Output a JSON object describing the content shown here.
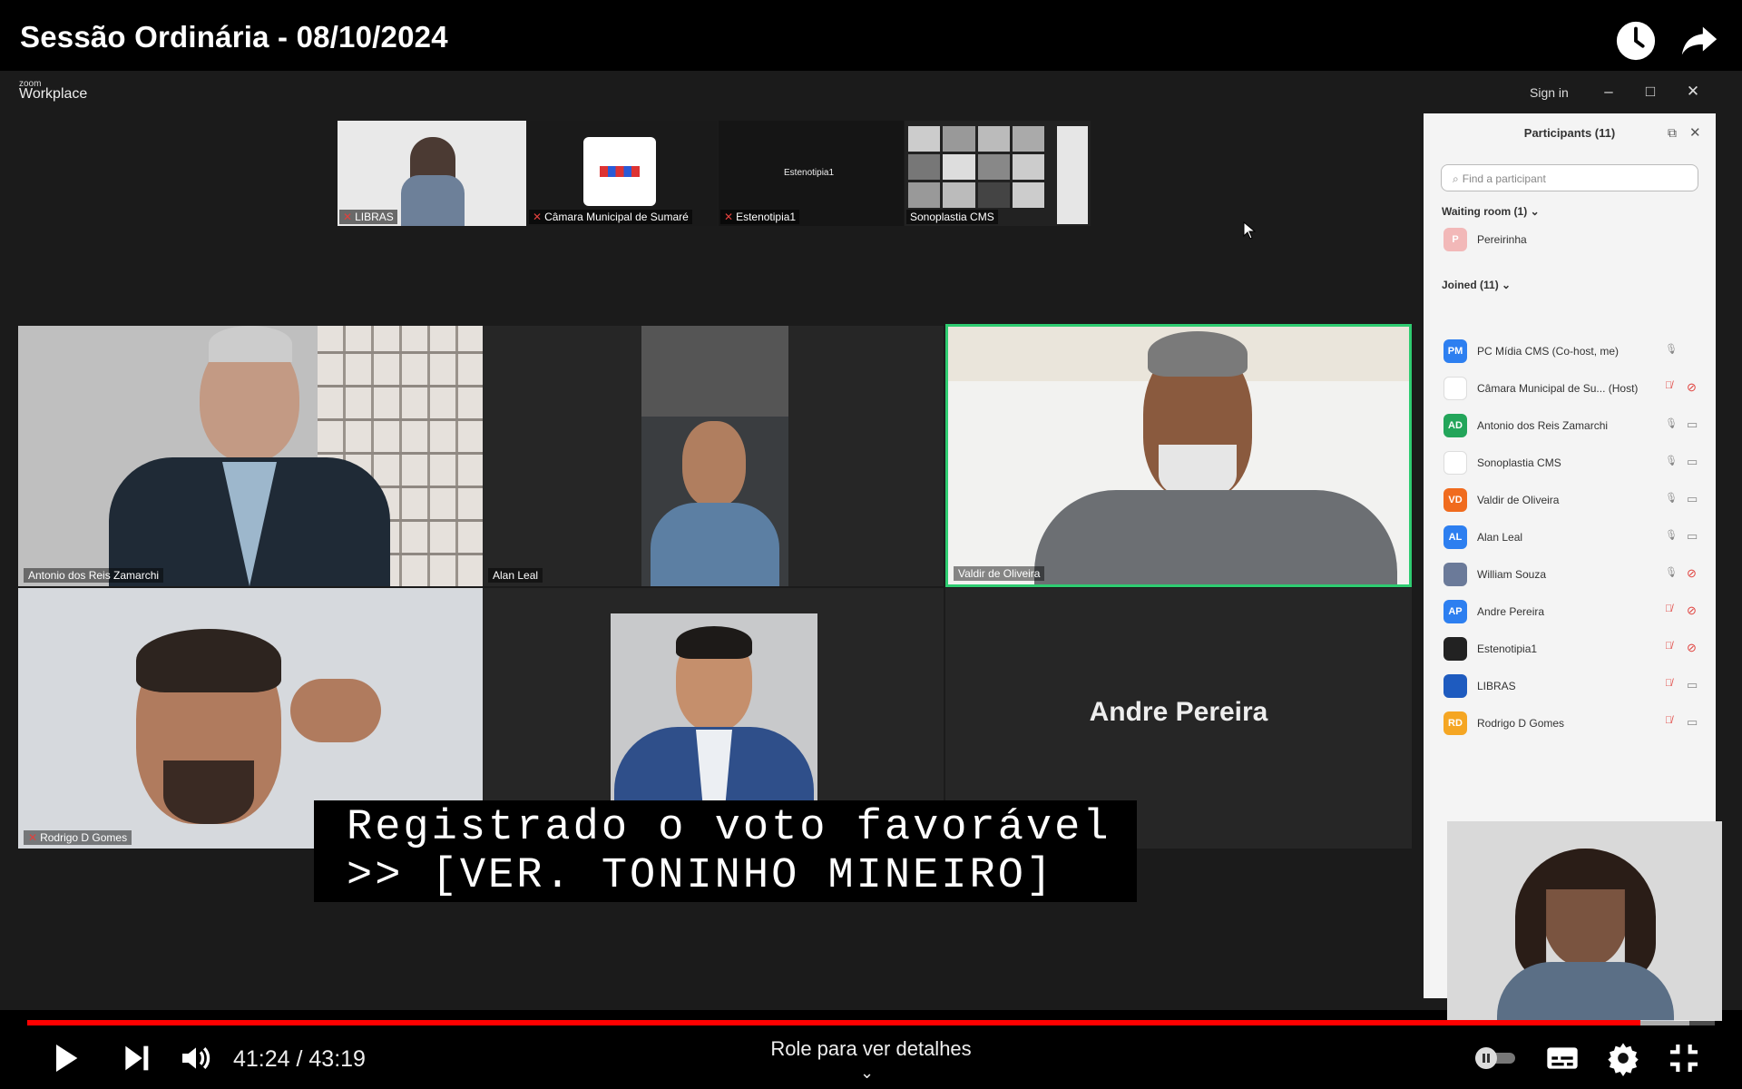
{
  "video": {
    "title": "Sessão Ordinária - 08/10/2024",
    "current_time": "41:24",
    "total_time": "43:19",
    "time_display": "41:24 / 43:19",
    "progress": 0.956,
    "buffered": 0.985,
    "scroll_hint": "Role para ver detalhes"
  },
  "zoom": {
    "logo_small": "zoom",
    "logo_big": "Workplace",
    "sign_in": "Sign in",
    "top_strip": [
      {
        "label": "LIBRAS"
      },
      {
        "label": "Câmara Municipal de Sumaré"
      },
      {
        "label": "Estenotipia1",
        "screen_text": "Estenotipia1"
      },
      {
        "label": "Sonoplastia CMS"
      }
    ],
    "gallery": [
      {
        "label": "Antonio dos Reis Zamarchi"
      },
      {
        "label": "Alan Leal"
      },
      {
        "label": "Valdir de Oliveira"
      },
      {
        "label": "Rodrigo D Gomes"
      },
      {
        "label": ""
      },
      {
        "name_card": "Andre Pereira"
      }
    ],
    "caption": {
      "line1": "Registrado o voto favorável",
      "line2": ">> [VER. TONINHO MINEIRO]"
    }
  },
  "participants": {
    "title": "Participants (11)",
    "search_placeholder": "Find a participant",
    "waiting_room": "Waiting room (1)",
    "waiting": [
      {
        "name": "Pereirinha",
        "initials": "P",
        "color": "#f2b8b8"
      }
    ],
    "joined": "Joined (11)",
    "list": [
      {
        "name": "PC Mídia CMS (Co-host, me)",
        "initials": "PM",
        "color": "#2d7ff0",
        "mic": "on",
        "cam": ""
      },
      {
        "name": "Câmara Municipal de Su...  (Host)",
        "initials": "",
        "color": "#ffffff",
        "mic": "off",
        "cam": "off"
      },
      {
        "name": "Antonio dos Reis Zamarchi",
        "initials": "AD",
        "color": "#23a55a",
        "mic": "on",
        "cam": "on"
      },
      {
        "name": "Sonoplastia CMS",
        "initials": "",
        "color": "#ffffff",
        "mic": "on",
        "cam": "on"
      },
      {
        "name": "Valdir de Oliveira",
        "initials": "VD",
        "color": "#f06b1e",
        "mic": "on",
        "cam": "on"
      },
      {
        "name": "Alan Leal",
        "initials": "AL",
        "color": "#2d7ff0",
        "mic": "on",
        "cam": "on"
      },
      {
        "name": "William Souza",
        "initials": "",
        "color": "#6b7a99",
        "mic": "on",
        "cam": "off"
      },
      {
        "name": "Andre Pereira",
        "initials": "AP",
        "color": "#2d7ff0",
        "mic": "off",
        "cam": "off"
      },
      {
        "name": "Estenotipia1",
        "initials": "",
        "color": "#222222",
        "mic": "off",
        "cam": "off"
      },
      {
        "name": "LIBRAS",
        "initials": "",
        "color": "#1e5bbf",
        "mic": "off",
        "cam": "on"
      },
      {
        "name": "Rodrigo D Gomes",
        "initials": "RD",
        "color": "#f5a623",
        "mic": "off",
        "cam": "on"
      }
    ]
  },
  "icons": {
    "watch_later": "clock-icon",
    "share": "share-icon",
    "play": "play-icon",
    "next": "next-icon",
    "volume": "volume-icon",
    "autoplay": "autoplay-toggle-icon",
    "subtitles": "subtitles-icon",
    "settings": "gear-icon",
    "fullscreen_exit": "exit-fullscreen-icon"
  },
  "colors": {
    "progress": "#ff0000",
    "active_speaker_border": "#2ecc71",
    "mic_off": "#e0413d"
  }
}
